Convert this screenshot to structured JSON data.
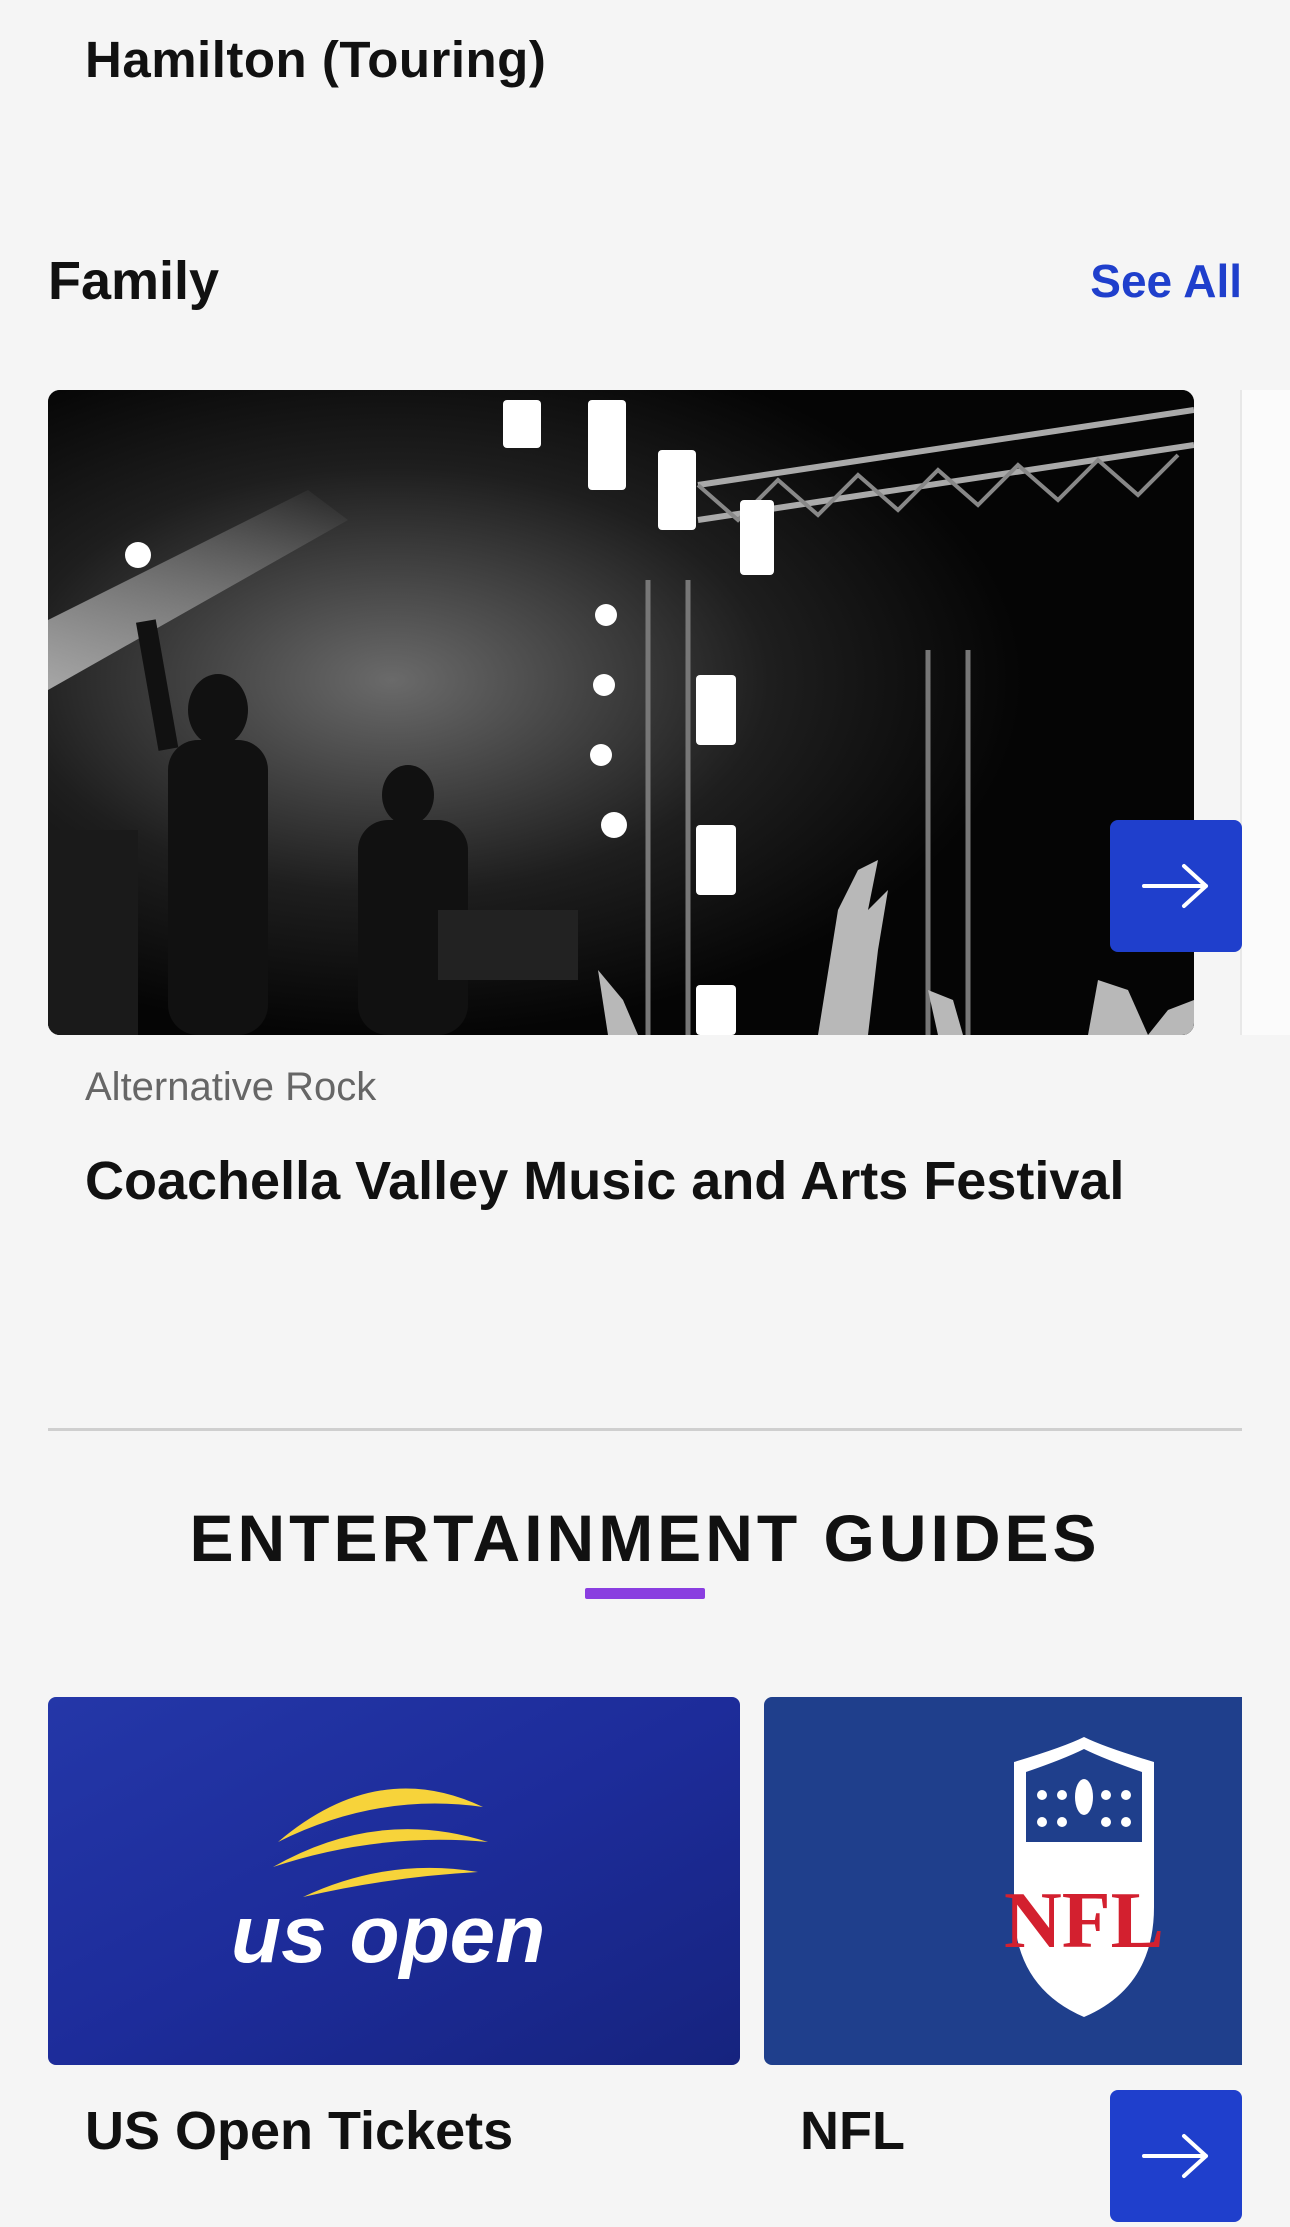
{
  "previous_section": {
    "item_title": "Hamilton (Touring)"
  },
  "family": {
    "title": "Family",
    "see_all": "See All",
    "card": {
      "genre": "Alternative Rock",
      "name": "Coachella Valley Music and Arts Festival"
    },
    "next_icon": "arrow-right-icon"
  },
  "guides": {
    "title": "ENTERTAINMENT GUIDES",
    "accent_color": "#8a3ee0",
    "items": [
      {
        "label": "US Open Tickets",
        "logo_text": "us open"
      },
      {
        "label": "NFL",
        "logo_text": "NFL"
      }
    ]
  },
  "colors": {
    "brand_blue": "#1f3fcc",
    "background": "#f5f5f5"
  }
}
